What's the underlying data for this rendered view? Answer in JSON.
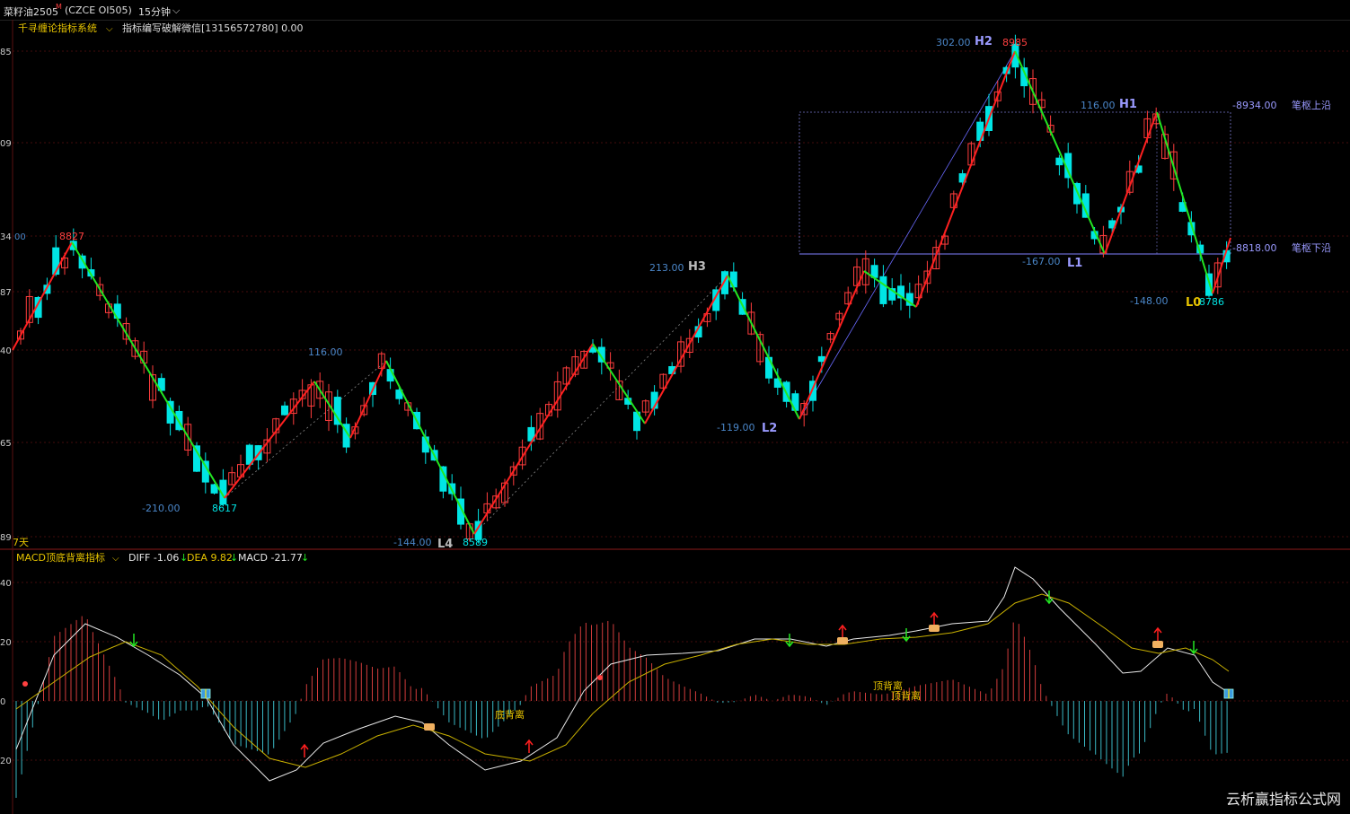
{
  "header": {
    "symbol": "菜籽油2505",
    "symbol_sup": "M",
    "code": "(CZCE OI505)",
    "period": "15分钟",
    "period_chevron": "chevron-down-icon"
  },
  "main_panel": {
    "indicator_name": "千寻缠论指标系统",
    "indicator_desc": "指标编写破解微信[13156572780] 0.00",
    "y_ticks": [
      "85",
      "09",
      "34",
      "87",
      "40",
      "65",
      "89"
    ],
    "y_tick_partial": "00",
    "footer_label": "7天",
    "box_top_label": "-8934.00",
    "box_top_name": "笔枢上沿",
    "box_bottom_label": "-8818.00",
    "box_bottom_name": "笔枢下沿"
  },
  "pivots": [
    {
      "name": "8827",
      "label": "8827"
    },
    {
      "name": "8617",
      "label": "8617"
    },
    {
      "name": "minus210",
      "label": "-210.00"
    },
    {
      "name": "116a",
      "label": "116.00"
    },
    {
      "name": "minus144",
      "label": "-144.00"
    },
    {
      "name": "L4",
      "label": "L4"
    },
    {
      "name": "8589",
      "label": "8589"
    },
    {
      "name": "213",
      "label": "213.00"
    },
    {
      "name": "H3",
      "label": "H3"
    },
    {
      "name": "minus119",
      "label": "-119.00"
    },
    {
      "name": "L2",
      "label": "L2"
    },
    {
      "name": "302",
      "label": "302.00"
    },
    {
      "name": "H2",
      "label": "H2"
    },
    {
      "name": "8985",
      "label": "8985"
    },
    {
      "name": "116b",
      "label": "116.00"
    },
    {
      "name": "H1",
      "label": "H1"
    },
    {
      "name": "minus167",
      "label": "-167.00"
    },
    {
      "name": "L1",
      "label": "L1"
    },
    {
      "name": "minus148",
      "label": "-148.00"
    },
    {
      "name": "L0",
      "label": "L0"
    },
    {
      "name": "8786",
      "label": "8786"
    }
  ],
  "macd_panel": {
    "title": "MACD顶底背离指标",
    "diff": "DIFF -1.06",
    "dea": "DEA 9.82",
    "macd": "MACD -21.77",
    "arrow": "↓",
    "y_ticks": [
      "40",
      "20",
      "0",
      "20"
    ],
    "divergence_labels": [
      "底背离",
      "顶背离",
      "顶背离"
    ]
  },
  "colors": {
    "up": "#ff3d3d",
    "down": "#00e5e5",
    "stroke_up": "#ff2020",
    "stroke_down": "#22e622",
    "grid": "#5a1010",
    "label_blue": "#4a86c8",
    "label_purple": "#9a9aff",
    "yellow": "#e6c300"
  },
  "watermark": "云析赢指标公式网"
}
